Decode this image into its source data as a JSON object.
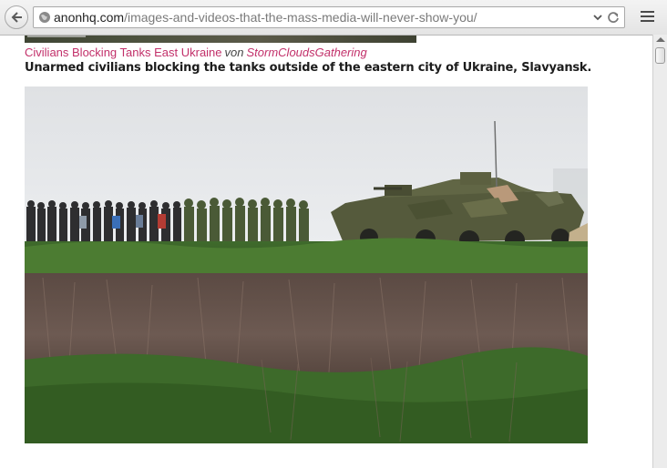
{
  "browser": {
    "url_domain": "anonhq.com",
    "url_path": "/images-and-videos-that-the-mass-media-will-never-show-you/"
  },
  "article": {
    "photo_caption": {
      "title": "Civilians Blocking Tanks East Ukraine",
      "by_word": "von",
      "author": "StormCloudsGathering"
    },
    "headline": "Unarmed civilians blocking the tanks outside of the eastern city of Ukraine, Slavyansk."
  },
  "icons": {
    "back": "back-arrow-icon",
    "globe": "globe-icon",
    "dropdown": "chevron-down-icon",
    "reload": "reload-icon",
    "menu": "hamburger-menu-icon"
  },
  "colors": {
    "link": "#c2306a",
    "headline": "#1c1c1c"
  }
}
